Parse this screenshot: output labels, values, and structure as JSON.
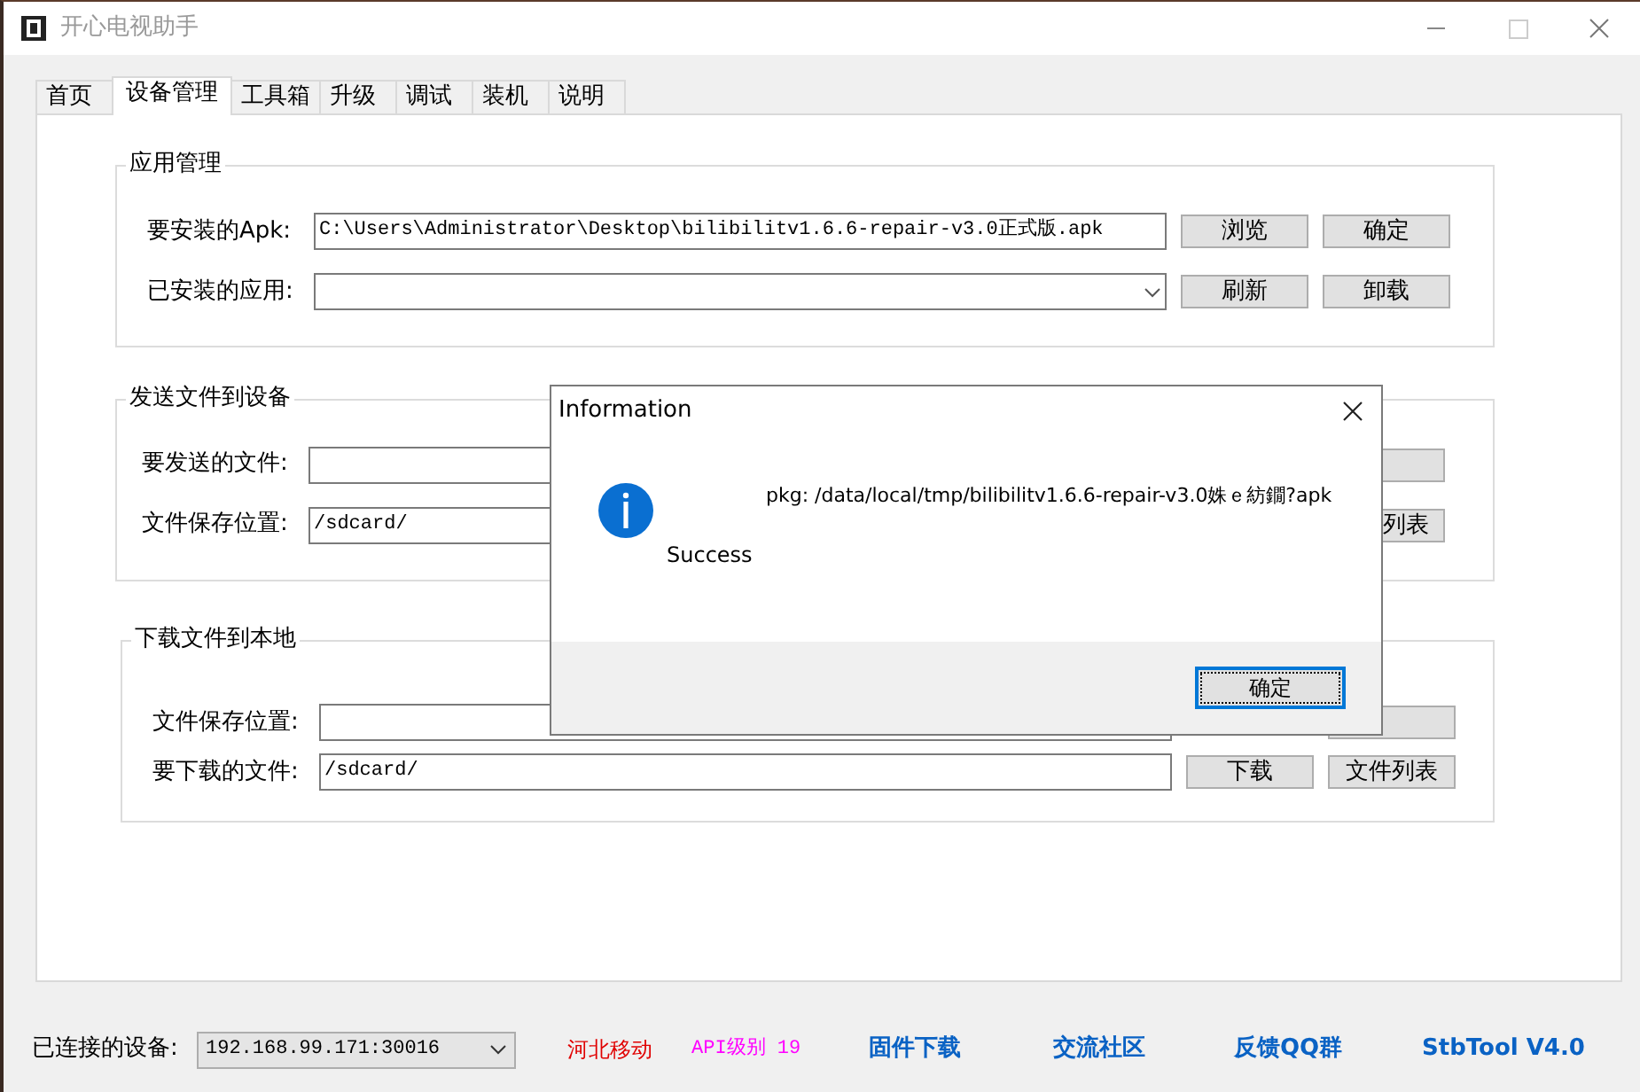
{
  "window": {
    "title": "开心电视助手"
  },
  "tabs": [
    {
      "label": "首页",
      "selected": false
    },
    {
      "label": "设备管理",
      "selected": true
    },
    {
      "label": "工具箱",
      "selected": false
    },
    {
      "label": "升级",
      "selected": false
    },
    {
      "label": "调试",
      "selected": false
    },
    {
      "label": "装机",
      "selected": false
    },
    {
      "label": "说明",
      "selected": false
    }
  ],
  "sections": [
    {
      "title": "应用管理",
      "rows": [
        {
          "label": "要安装的Apk:",
          "field": {
            "kind": "text",
            "value": "C:\\Users\\Administrator\\Desktop\\bilibilitv1.6.6-repair-v3.0正式版.apk"
          },
          "buttons": [
            {
              "kind": "button",
              "label": "浏览"
            },
            {
              "kind": "button",
              "label": "确定"
            }
          ]
        },
        {
          "label": "已安装的应用:",
          "field": {
            "kind": "dropdown"
          },
          "buttons": [
            {
              "kind": "button",
              "label": "刷新"
            },
            {
              "kind": "button",
              "label": "卸载"
            }
          ]
        }
      ]
    },
    {
      "title": "发送文件到设备",
      "rows": [
        {
          "label": "要发送的文件:",
          "field": {
            "kind": "text"
          },
          "buttons": [
            {
              "kind": "covered"
            },
            {
              "kind": "button"
            }
          ]
        },
        {
          "label": "文件保存位置:",
          "field": {
            "kind": "text",
            "value": "/sdcard/"
          },
          "buttons": [
            {
              "kind": "covered"
            },
            {
              "kind": "button",
              "label": "列表"
            }
          ]
        }
      ]
    },
    {
      "title": "下载文件到本地",
      "rows": [
        {
          "label": "文件保存位置:",
          "field": {
            "kind": "text"
          },
          "buttons": [
            {
              "kind": "covered"
            },
            {
              "kind": "button"
            }
          ]
        },
        {
          "label": "要下载的文件:",
          "field": {
            "kind": "text",
            "value": "/sdcard/"
          },
          "buttons": [
            {
              "kind": "button",
              "label": "下载"
            },
            {
              "kind": "button",
              "label": "文件列表"
            }
          ]
        }
      ]
    }
  ],
  "dialog": {
    "title": "Information",
    "message": "pkg: /data/local/tmp/bilibilitv1.6.6-repair-v3.0姝ｅ紡鐗?apk",
    "status": "Success",
    "button": "确定"
  },
  "status_bar": {
    "label": "已连接的设备:",
    "device": "192.168.99.171:30016",
    "carrier": "河北移动",
    "api_level": "API级别 19",
    "links": [
      "固件下载",
      "交流社区",
      "反馈QQ群",
      "StbTool V4.0"
    ]
  }
}
